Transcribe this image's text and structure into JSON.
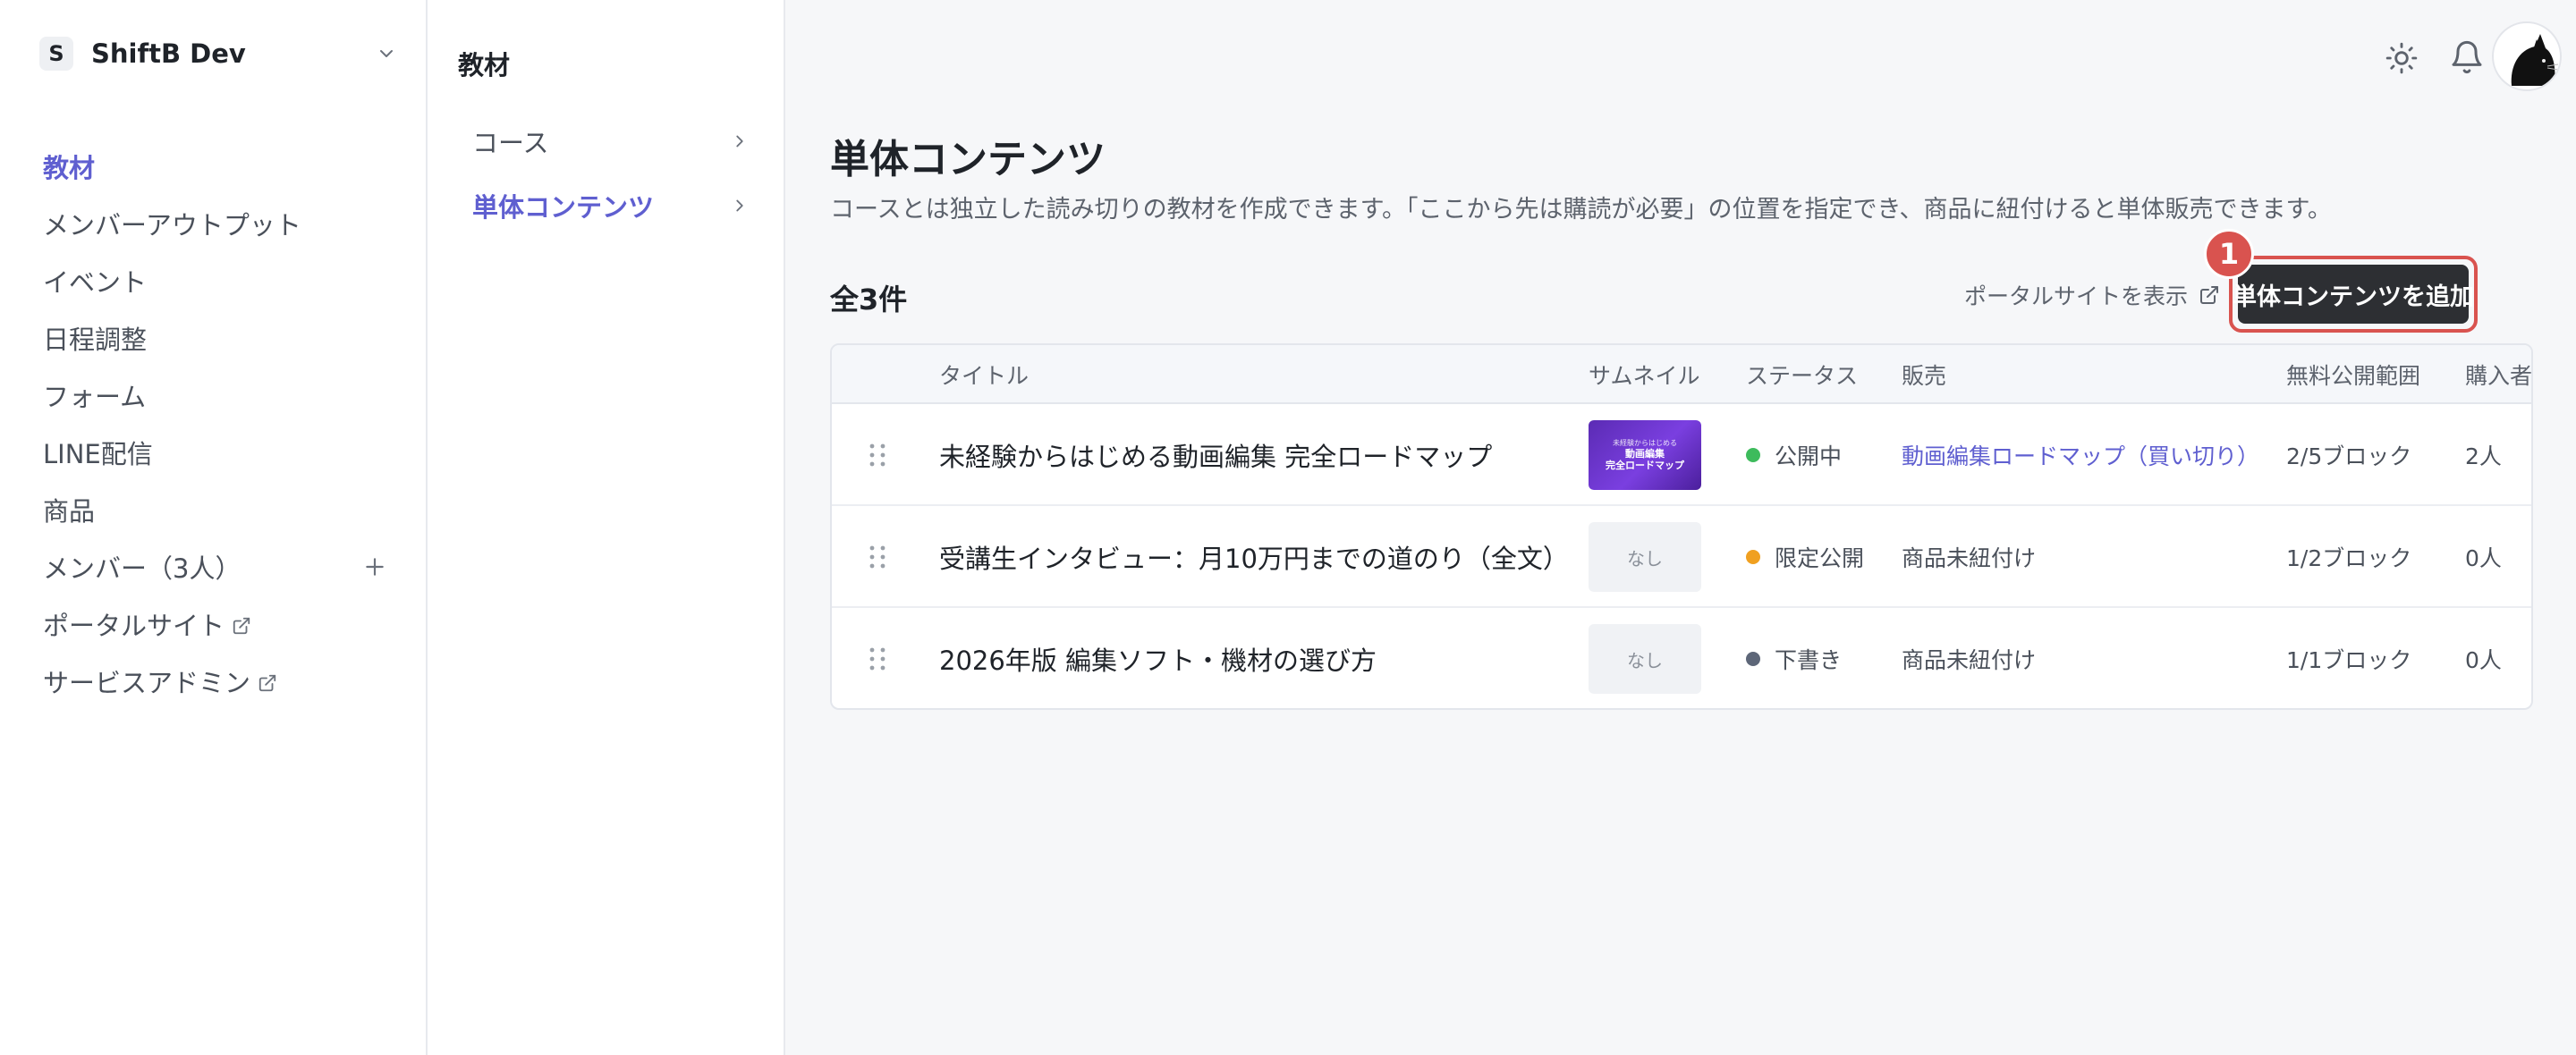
{
  "workspace": {
    "badge": "S",
    "name": "ShiftB Dev"
  },
  "sidebar": {
    "items": [
      {
        "label": "教材",
        "active": true
      },
      {
        "label": "メンバーアウトプット"
      },
      {
        "label": "イベント"
      },
      {
        "label": "日程調整"
      },
      {
        "label": "フォーム"
      },
      {
        "label": "LINE配信"
      },
      {
        "label": "商品"
      },
      {
        "label": "メンバー（3人）",
        "action_icon": "plus-icon"
      },
      {
        "label": "ポータルサイト",
        "icon": "external-link-icon"
      },
      {
        "label": "サービスアドミン",
        "icon": "external-link-icon"
      }
    ]
  },
  "subnav": {
    "title": "教材",
    "items": [
      {
        "label": "コース"
      },
      {
        "label": "単体コンテンツ",
        "active": true
      }
    ]
  },
  "topbar": {
    "icons": [
      "sun-icon",
      "bell-icon",
      "avatar"
    ]
  },
  "page": {
    "title": "単体コンテンツ",
    "description": "コースとは独立した読み切りの教材を作成できます。「ここから先は購読が必要」の位置を指定でき、商品に紐付けると単体販売できます。",
    "count": "全3件",
    "portal_link": "ポータルサイトを表示",
    "add_button": "単体コンテンツを追加",
    "step_badge": "1"
  },
  "table": {
    "headers": [
      "タイトル",
      "サムネイル",
      "ステータス",
      "販売",
      "無料公開範囲",
      "購入者"
    ],
    "rows": [
      {
        "title": "未経験からはじめる動画編集 完全ロードマップ",
        "thumbnail": {
          "lines": [
            "未経験からはじめる",
            "動画編集",
            "完全ロードマップ"
          ]
        },
        "status": "公開中",
        "status_color": "#3dbb5c",
        "sale": "動画編集ロードマップ（買い切り）",
        "sale_linked": true,
        "free_range": "2/5ブロック",
        "buyers": "2人"
      },
      {
        "title": "受講生インタビュー：月10万円までの道のり（全文）",
        "thumbnail": {
          "none_label": "なし"
        },
        "status": "限定公開",
        "status_color": "#f0a020",
        "sale": "商品未紐付け",
        "sale_linked": false,
        "free_range": "1/2ブロック",
        "buyers": "0人"
      },
      {
        "title": "2026年版 編集ソフト・機材の選び方",
        "thumbnail": {
          "none_label": "なし"
        },
        "status": "下書き",
        "status_color": "#5d6678",
        "sale": "商品未紐付け",
        "sale_linked": false,
        "free_range": "1/1ブロック",
        "buyers": "0人"
      }
    ]
  },
  "colors": {
    "accent": "#5f5fd0",
    "highlight": "#d9534f",
    "primary_button": "#2d2f33"
  }
}
